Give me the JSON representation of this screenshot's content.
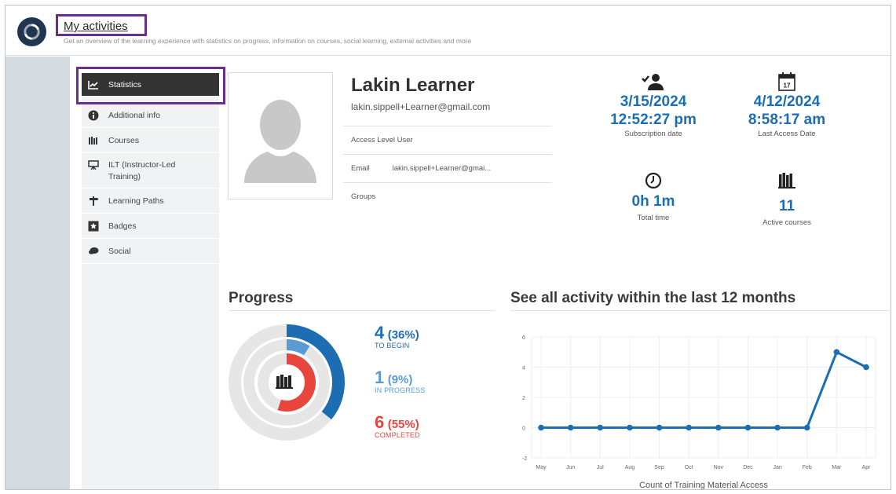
{
  "header": {
    "title": "My activities",
    "subtitle": "Get an overview of the learning experience with statistics on progress, information on courses, social learning, external activities and more"
  },
  "sidebar": {
    "items": [
      {
        "label": "Statistics",
        "icon": "chart-icon",
        "active": true
      },
      {
        "label": "Additional info",
        "icon": "info-icon"
      },
      {
        "label": "Courses",
        "icon": "books-icon"
      },
      {
        "label": "ILT (Instructor-Led Training)",
        "icon": "presentation-icon"
      },
      {
        "label": "Learning Paths",
        "icon": "signpost-icon"
      },
      {
        "label": "Badges",
        "icon": "star-badge-icon"
      },
      {
        "label": "Social",
        "icon": "speech-bubbles-icon"
      }
    ]
  },
  "profile": {
    "name": "Lakin Learner",
    "email": "lakin.sippell+Learner@gmail.com",
    "access_level_label": "Access Level",
    "access_level_value": "User",
    "email_label": "Email",
    "email_value": "lakin.sippell+Learner@gmai...",
    "groups_label": "Groups"
  },
  "stats": {
    "subscription_date": "3/15/2024",
    "subscription_time": "12:52:27 pm",
    "subscription_caption": "Subscription date",
    "last_access_date": "4/12/2024",
    "last_access_time": "8:58:17 am",
    "last_access_caption": "Last Access Date",
    "calendar_day": "17",
    "total_time": "0h 1m",
    "total_time_caption": "Total time",
    "active_courses": "11",
    "active_courses_caption": "Active courses"
  },
  "progress": {
    "title": "Progress",
    "to_begin": {
      "count": "4",
      "pct": "(36%)",
      "label": "TO BEGIN",
      "fraction": 0.36
    },
    "in_progress": {
      "count": "1",
      "pct": "(9%)",
      "label": "IN PROGRESS",
      "fraction": 0.09
    },
    "completed": {
      "count": "6",
      "pct": "(55%)",
      "label": "COMPLETED",
      "fraction": 0.55
    }
  },
  "activity": {
    "title": "See all activity within the last 12 months"
  },
  "colors": {
    "accent": "#1d6db3",
    "light_blue": "#5b9bd5",
    "red": "#e8453c",
    "highlight": "#6a2d91"
  },
  "chart_data": {
    "type": "line",
    "categories": [
      "May",
      "Jun",
      "Jul",
      "Aug",
      "Sep",
      "Oct",
      "Nov",
      "Dec",
      "Jan",
      "Feb",
      "Mar",
      "Apr"
    ],
    "values": [
      0,
      0,
      0,
      0,
      0,
      0,
      0,
      0,
      0,
      0,
      5,
      4
    ],
    "xlabel": "Count of Training Material Access",
    "ylabel": "",
    "ylim": [
      -2,
      6
    ],
    "yticks": [
      -2,
      0,
      2,
      4,
      6
    ],
    "grid": true
  }
}
